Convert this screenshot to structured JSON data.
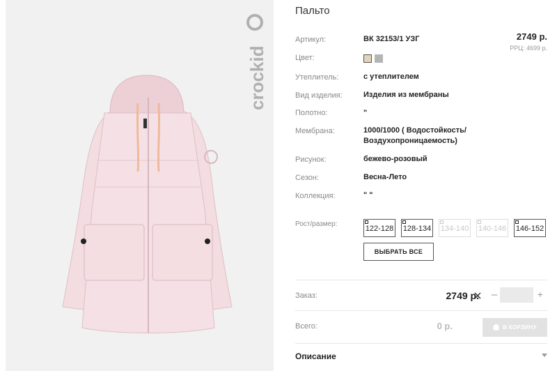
{
  "product": {
    "title": "Пальто",
    "brand": "crockid",
    "price": "2749 р.",
    "rrp": "РРЦ: 4699 р."
  },
  "specs": [
    {
      "label": "Артикул:",
      "value": "ВК 32153/1 УЗГ"
    },
    {
      "label": "Цвет:",
      "value": ""
    },
    {
      "label": "Утеплитель:",
      "value": "с утеплителем"
    },
    {
      "label": "Вид изделия:",
      "value": "Изделия из мембраны"
    },
    {
      "label": "Полотно:",
      "value": "\""
    },
    {
      "label": "Мембрана:",
      "value": "1000/1000 ( Водостойкость/ Воздухопроницаемость)"
    },
    {
      "label": "Рисунок:",
      "value": "бежево-розовый"
    },
    {
      "label": "Сезон:",
      "value": "Весна-Лето"
    },
    {
      "label": "Коллекция:",
      "value": "\" \""
    },
    {
      "label": "Рост/размер:",
      "value": ""
    }
  ],
  "colors": {
    "swatch_beige": "#e2d4b8",
    "swatch_grey": "#b5b5b5",
    "jacket": "#f2dce0",
    "drawstring": "#f0b99a"
  },
  "sizes": [
    {
      "label": "122-128",
      "available": true
    },
    {
      "label": "128-134",
      "available": true
    },
    {
      "label": "134-140",
      "available": false
    },
    {
      "label": "140-146",
      "available": false
    },
    {
      "label": "146-152",
      "available": true
    }
  ],
  "select_all_label": "ВЫБРАТЬ ВСЕ",
  "order": {
    "label": "Заказ:",
    "price": "2749 р.",
    "minus": "–",
    "plus": "+",
    "quantity": "",
    "total_label": "Всего:",
    "total": "0 р.",
    "cart_label": "В КОРЗИНУ"
  },
  "description_label": "Описание"
}
